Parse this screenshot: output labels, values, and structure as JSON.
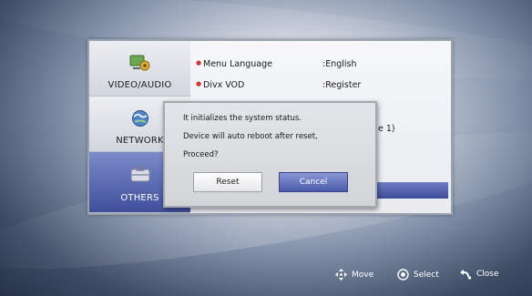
{
  "sidebar": {
    "items": [
      {
        "label": "VIDEO/AUDIO",
        "icon": "video-audio-icon",
        "active": false
      },
      {
        "label": "NETWORK",
        "icon": "globe-network-icon",
        "active": false
      },
      {
        "label": "OTHERS",
        "icon": "toolbox-icon",
        "active": true
      }
    ]
  },
  "settings": {
    "rows": [
      {
        "label": "Menu Language",
        "value": ":English"
      },
      {
        "label": "Divx VOD",
        "value": ":Register"
      }
    ],
    "partial_value": "e 1)"
  },
  "dialog": {
    "message_lines": [
      "It initializes the system status.",
      "Device will auto reboot after reset,",
      "Proceed?"
    ],
    "reset_label": "Reset",
    "cancel_label": "Cancel"
  },
  "footer": {
    "move_label": "Move",
    "select_label": "Select",
    "close_label": "Close"
  },
  "colors": {
    "accent": "#4a5aa8",
    "bullet": "#d23a3a"
  }
}
